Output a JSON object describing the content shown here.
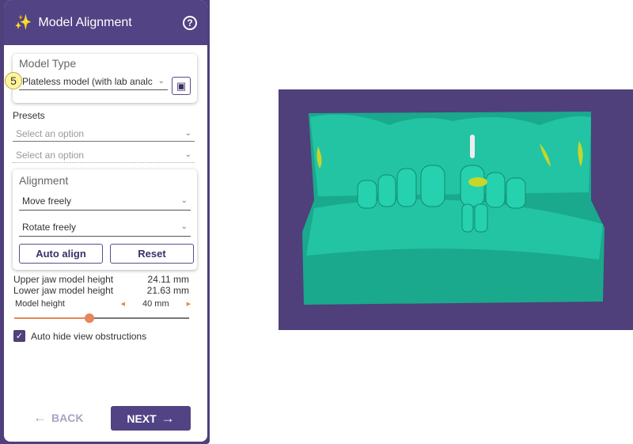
{
  "header": {
    "title": "Model Alignment",
    "icon": "magic-wand-icon",
    "help": "?"
  },
  "model_type": {
    "title": "Model Type",
    "value": "Plateless model (with lab analc",
    "step_badge": "5"
  },
  "presets": {
    "label": "Presets",
    "select1_placeholder": "Select an option",
    "select2_placeholder": "Select an option"
  },
  "alignment": {
    "title": "Alignment",
    "move": "Move freely",
    "rotate": "Rotate freely",
    "auto_align": "Auto align",
    "reset": "Reset"
  },
  "measurements": {
    "upper_label": "Upper jaw model height",
    "upper_value": "24.11 mm",
    "lower_label": "Lower jaw model height",
    "lower_value": "21.63 mm"
  },
  "model_height": {
    "label": "Model height",
    "value": "40 mm",
    "slider_fraction": 0.43
  },
  "auto_hide": {
    "label": "Auto hide view obstructions",
    "checked": true
  },
  "footer": {
    "back": "BACK",
    "next": "NEXT"
  },
  "colors": {
    "accent": "#514384",
    "slider": "#e8855a",
    "model": "#1fb89a",
    "viewport_bg": "#4f3f7a",
    "badge": "#fff59d"
  }
}
